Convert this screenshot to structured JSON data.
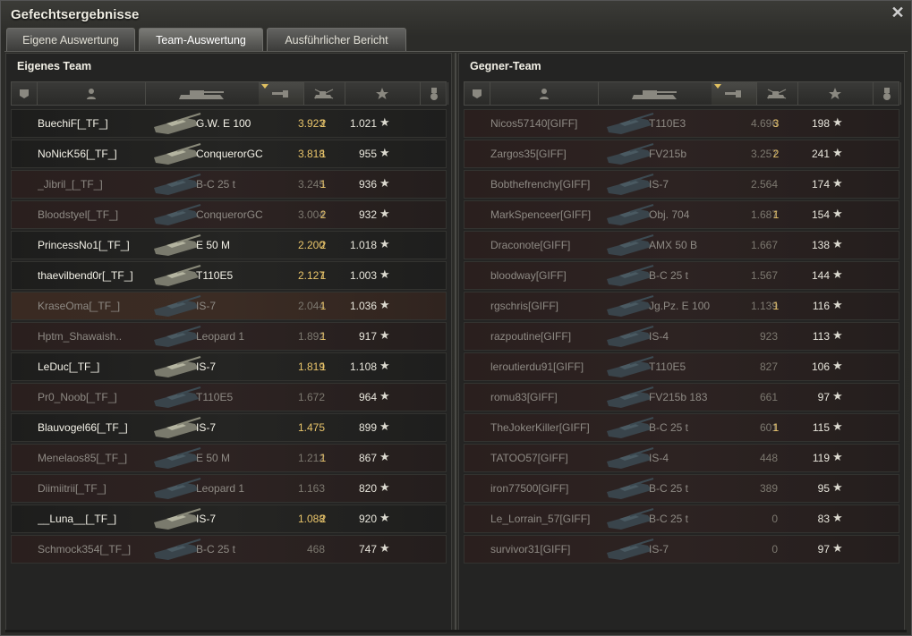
{
  "window": {
    "title": "Gefechtsergebnisse"
  },
  "tabs": [
    {
      "label": "Eigene Auswertung",
      "active": false
    },
    {
      "label": "Team-Auswertung",
      "active": true
    },
    {
      "label": "Ausführlicher Bericht",
      "active": false
    }
  ],
  "columns": {
    "icons": [
      "badge-icon",
      "player-icon",
      "tank-icon",
      "damage-icon",
      "kills-icon",
      "xp-star-icon",
      "medal-icon"
    ],
    "sorted_column": "damage"
  },
  "colors": {
    "accent_gold": "#e8c46a",
    "alive_text": "#f4f2e8",
    "dead_text": "#8e8a84"
  },
  "own_team": {
    "title": "Eigenes Team",
    "rows": [
      {
        "name": "BuechiF[_TF_]",
        "vehicle": "G.W. E 100",
        "damage": "3.923",
        "kills": "2",
        "xp": "1.021",
        "alive": true
      },
      {
        "name": "NoNicK56[_TF_]",
        "vehicle": "ConquerorGC",
        "damage": "3.818",
        "kills": "1",
        "xp": "955",
        "alive": true
      },
      {
        "name": "_Jibril_[_TF_]",
        "vehicle": "B-C 25 t",
        "damage": "3.245",
        "kills": "1",
        "xp": "936",
        "alive": false
      },
      {
        "name": "Bloodstyel[_TF_]",
        "vehicle": "ConquerorGC",
        "damage": "3.004",
        "kills": "2",
        "xp": "932",
        "alive": false
      },
      {
        "name": "PrincessNo1[_TF_]",
        "vehicle": "E 50 M",
        "damage": "2.200",
        "kills": "2",
        "xp": "1.018",
        "alive": true
      },
      {
        "name": "thaevilbend0r[_TF_]",
        "vehicle": "T110E5",
        "damage": "2.127",
        "kills": "1",
        "xp": "1.003",
        "alive": true
      },
      {
        "name": "KraseOma[_TF_]",
        "vehicle": "IS-7",
        "damage": "2.044",
        "kills": "1",
        "xp": "1.036",
        "alive": false,
        "highlight": true
      },
      {
        "name": "Hptm_Shawaish..",
        "vehicle": "Leopard 1",
        "damage": "1.892",
        "kills": "1",
        "xp": "917",
        "alive": false
      },
      {
        "name": "LeDuc[_TF_]",
        "vehicle": "IS-7",
        "damage": "1.819",
        "kills": "1",
        "xp": "1.108",
        "alive": true
      },
      {
        "name": "Pr0_Noob[_TF_]",
        "vehicle": "T110E5",
        "damage": "1.672",
        "kills": "",
        "xp": "964",
        "alive": false
      },
      {
        "name": "Blauvogel66[_TF_]",
        "vehicle": "IS-7",
        "damage": "1.475",
        "kills": "",
        "xp": "899",
        "alive": true
      },
      {
        "name": "Menelaos85[_TF_]",
        "vehicle": "E 50 M",
        "damage": "1.212",
        "kills": "1",
        "xp": "867",
        "alive": false
      },
      {
        "name": "Diimiitrii[_TF_]",
        "vehicle": "Leopard 1",
        "damage": "1.163",
        "kills": "",
        "xp": "820",
        "alive": false
      },
      {
        "name": "__Luna__[_TF_]",
        "vehicle": "IS-7",
        "damage": "1.088",
        "kills": "2",
        "xp": "920",
        "alive": true
      },
      {
        "name": "Schmock354[_TF_]",
        "vehicle": "B-C 25 t",
        "damage": "468",
        "kills": "",
        "xp": "747",
        "alive": false
      }
    ]
  },
  "enemy_team": {
    "title": "Gegner-Team",
    "rows": [
      {
        "name": "Nicos57140[GIFF]",
        "vehicle": "T110E3",
        "damage": "4.696",
        "kills": "3",
        "xp": "198",
        "alive": false
      },
      {
        "name": "Zargos35[GIFF]",
        "vehicle": "FV215b",
        "damage": "3.257",
        "kills": "2",
        "xp": "241",
        "alive": false
      },
      {
        "name": "Bobthefrenchy[GIFF]",
        "vehicle": "IS-7",
        "damage": "2.564",
        "kills": "",
        "xp": "174",
        "alive": false
      },
      {
        "name": "MarkSpenceer[GIFF]",
        "vehicle": "Obj. 704",
        "damage": "1.687",
        "kills": "1",
        "xp": "154",
        "alive": false
      },
      {
        "name": "Draconote[GIFF]",
        "vehicle": "AMX 50 B",
        "damage": "1.667",
        "kills": "",
        "xp": "138",
        "alive": false
      },
      {
        "name": "bloodway[GIFF]",
        "vehicle": "B-C 25 t",
        "damage": "1.567",
        "kills": "",
        "xp": "144",
        "alive": false
      },
      {
        "name": "rgschris[GIFF]",
        "vehicle": "Jg.Pz. E 100",
        "damage": "1.139",
        "kills": "1",
        "xp": "116",
        "alive": false
      },
      {
        "name": "razpoutine[GIFF]",
        "vehicle": "IS-4",
        "damage": "923",
        "kills": "",
        "xp": "113",
        "alive": false
      },
      {
        "name": "leroutierdu91[GIFF]",
        "vehicle": "T110E5",
        "damage": "827",
        "kills": "",
        "xp": "106",
        "alive": false
      },
      {
        "name": "romu83[GIFF]",
        "vehicle": "FV215b 183",
        "damage": "661",
        "kills": "",
        "xp": "97",
        "alive": false
      },
      {
        "name": "TheJokerKiller[GIFF]",
        "vehicle": "B-C 25 t",
        "damage": "601",
        "kills": "1",
        "xp": "115",
        "alive": false
      },
      {
        "name": "TATOO57[GIFF]",
        "vehicle": "IS-4",
        "damage": "448",
        "kills": "",
        "xp": "119",
        "alive": false
      },
      {
        "name": "iron77500[GIFF]",
        "vehicle": "B-C 25 t",
        "damage": "389",
        "kills": "",
        "xp": "95",
        "alive": false
      },
      {
        "name": "Le_Lorrain_57[GIFF]",
        "vehicle": "B-C 25 t",
        "damage": "0",
        "kills": "",
        "xp": "83",
        "alive": false
      },
      {
        "name": "survivor31[GIFF]",
        "vehicle": "IS-7",
        "damage": "0",
        "kills": "",
        "xp": "97",
        "alive": false
      }
    ]
  }
}
